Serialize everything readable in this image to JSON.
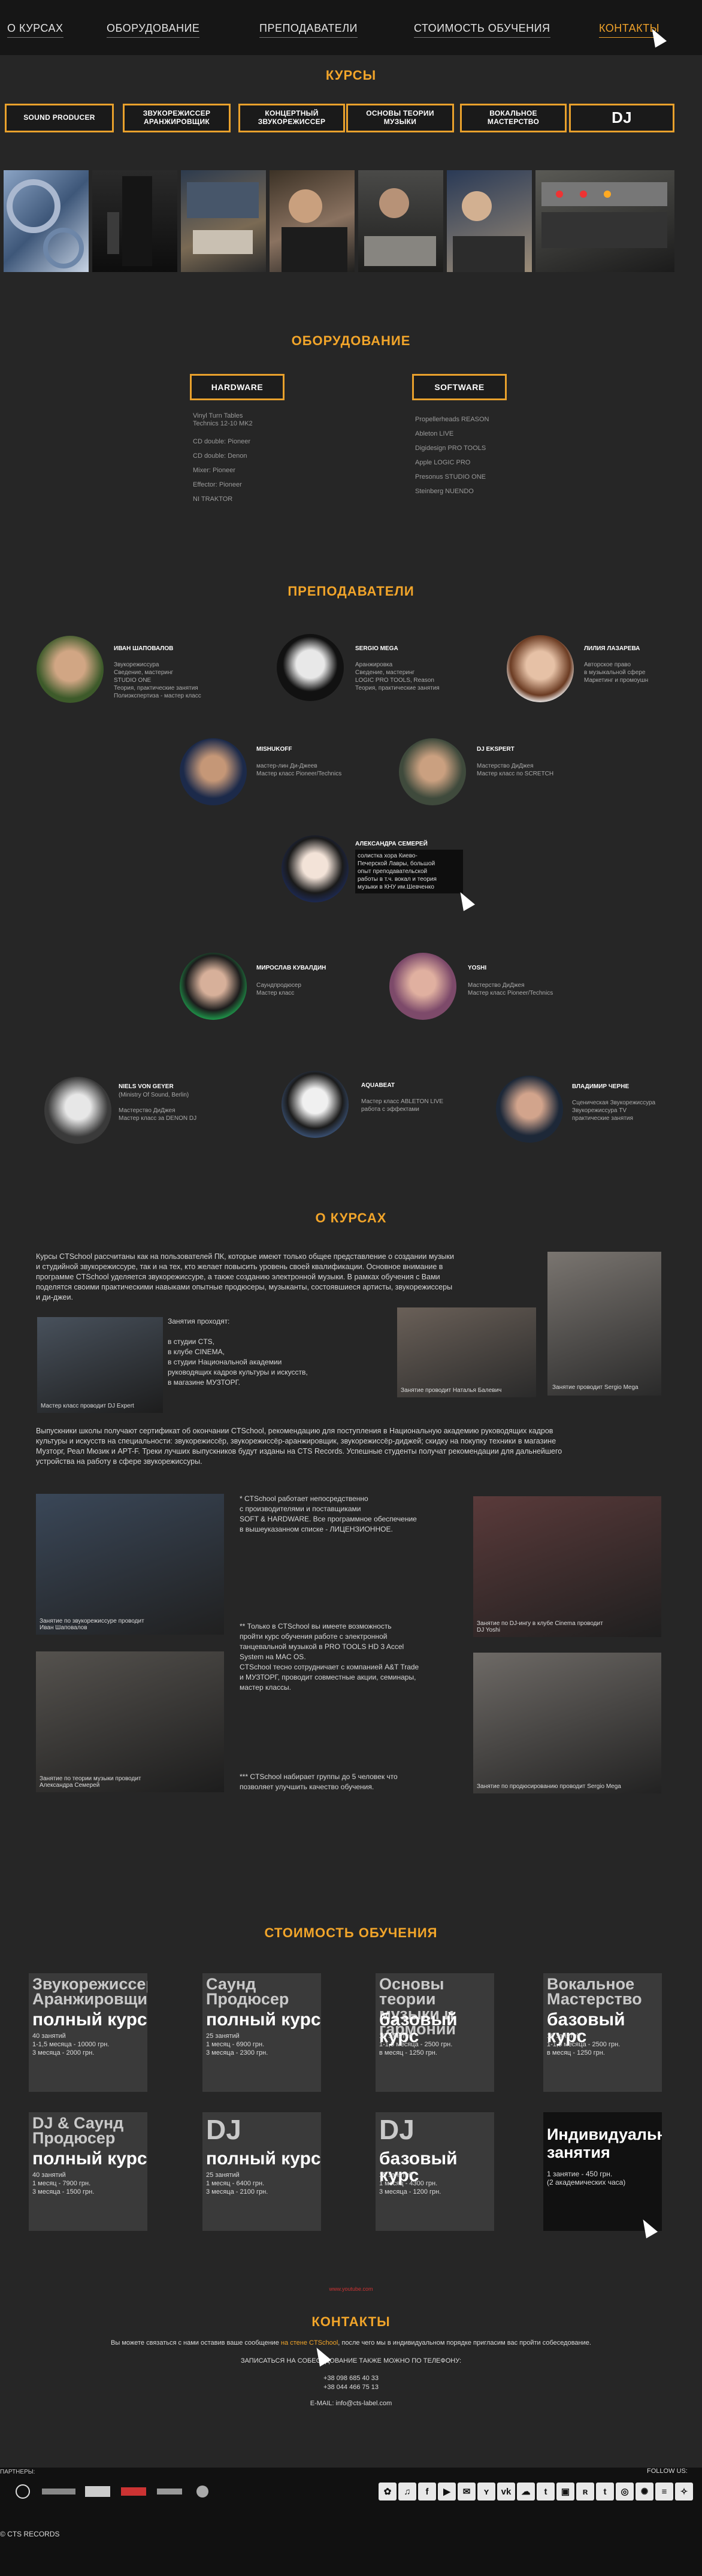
{
  "nav": {
    "items": [
      "О КУРСАХ",
      "ОБОРУДОВАНИЕ",
      "ПРЕПОДАВАТЕЛИ",
      "СТОИМОСТЬ ОБУЧЕНИЯ",
      "КОНТАКТЫ"
    ]
  },
  "courses": {
    "title": "КУРСЫ",
    "buttons": [
      "SOUND PRODUCER",
      "ЗВУКОРЕЖИССЕР\nАРАНЖИРОВЩИК",
      "КОНЦЕРТНЫЙ\nЗВУКОРЕЖИССЕР",
      "ОСНОВЫ ТЕОРИИ\nМУЗЫКИ",
      "ВОКАЛЬНОЕ\nМАСТЕРСТВО",
      "DJ"
    ]
  },
  "equipment": {
    "title": "ОБОРУДОВАНИЕ",
    "hardware_label": "HARDWARE",
    "software_label": "SOFTWARE",
    "hardware": [
      "Vinyl Turn Tables\nTechnics 12-10 MK2",
      "CD double: Pioneer",
      "CD double: Denon",
      "Mixer: Pioneer",
      "Effector: Pioneer",
      "NI TRAKTOR"
    ],
    "software": [
      "Propellerheads REASON",
      "Ableton LIVE",
      "Digidesign PRO TOOLS",
      "Apple LOGIC PRO",
      "Presonus STUDIO ONE",
      "Steinberg NUENDO"
    ]
  },
  "teachers": {
    "title": "ПРЕПОДАВАТЕЛИ",
    "list": [
      {
        "name": "ИВАН ШАПОВАЛОВ",
        "desc": "Звукорежиссура\nСведение, мастеринг\nSTUDIO ONE\nТеория, практические занятия\nПолиэкспертиза - мастер класс"
      },
      {
        "name": "SERGIO MEGA",
        "desc": "Аранжировка\nСведение, мастеринг\nLOGIC PRO TOOLS, Reason\nТеория, практические занятия"
      },
      {
        "name": "ЛИЛИЯ ЛАЗАРЕВА",
        "desc": "Авторское право\nв музыкальной сфере\nМаркетинг и промоушн"
      },
      {
        "name": "MISHUKOFF",
        "desc": "мастер-лин Ди-Джеев\nМастер класс Pioneer/Technics"
      },
      {
        "name": "DJ EKSPERT",
        "desc": "Мастерство ДиДжея\nМастер класс по SCRETCH"
      },
      {
        "name": "АЛЕКСАНДРА СЕМЕРЕЙ",
        "desc": "солистка хора Киево-\nПечерской Лавры, большой\nопыт преподавательской\nработы в т.ч. вокал и теория\nмузыки в КНУ им.Шевченко"
      },
      {
        "name": "МИРОСЛАВ КУВАЛДИН",
        "desc": "Саундпродюсер\nМастер класс"
      },
      {
        "name": "YOSHI",
        "desc": "Мастерство ДиДжея\nМастер класс Pioneer/Technics"
      },
      {
        "name": "NIELS VON GEYER",
        "desc": "(Ministry Of Sound, Berlin)\n\nМастерство ДиДжея\nМастер класс за DENON DJ"
      },
      {
        "name": "AQUABEAT",
        "desc": "Мастер класс ABLETON LIVE\nработа с эффектами"
      },
      {
        "name": "ВЛАДИМИР ЧЕРНЕ",
        "desc": "Сценическая Звукорежиссура\nЗвукорежиссура TV\nпрактические занятия"
      }
    ]
  },
  "about": {
    "title": "О КУРСАХ",
    "p1": "Курсы CTSchool рассчитаны как на пользователей ПК, которые имеют только общее представление о создании музыки\nи студийной звукорежиссуре, так и на тех, кто желает повысить уровень своей квалификации. Основное внимание в\nпрограмме CTSchool уделяется звукорежиссуре, а также созданию электронной музыки. В рамках обучения с Вами\nподелятся своими практическими навыками опытные продюсеры, музыканты, состоявшиеся артисты, звукорежиссеры\nи ди-джеи.",
    "p2": "Занятия проходят:\n\nв студии CTS,\nв клубе CINEMA,\nв студии Национальной академии\nруководящих кадров культуры и искусств,\nв магазине МУЗТОРГ.",
    "p3": "Выпускники школы получают сертификат об окончании CTSchool, рекомендацию для поступления в Национальную академию руководящих кадров\nкультуры и искусств на специальности: звукорежиссёр, звукорежиссёр-аранжировщик, звукорежиссёр-диджей; скидку на покупку техники в магазине\nМузторг, Реал Мюзик и APT-F. Треки лучших выпускников будут изданы на CTS Records. Успешные студенты получат рекомендации для дальнейшего\nустройства на работу в сфере звукорежиссуры.",
    "p4": "* CTSchool работает непосредственно\nс производителями и поставщиками\nSOFT & HARDWARE. Все программное обеспечение\nв вышеуказанном списке - ЛИЦЕНЗИОННОЕ.",
    "p5": "** Только в CTSchool вы имеете возможность\nпройти курс обучения работе с электронной\nтанцевальной музыкой в PRO TOOLS HD 3 Accel\nSystem на MAC OS.\nCTSchool тесно сотрудничает с компанией A&T Trade\nи МУЗТОРГ, проводит совместные акции, семинары,\nмастер классы.",
    "p6": "*** CTSchool набирает группы до 5 человек что\nпозволяет улучшить качество обучения.",
    "captions": [
      "Мастер класс проводит DJ Expert",
      "Занятие проводит Наталья Балевич",
      "Занятие проводит Sergio Mega",
      "Занятие по звукорежиссуре проводит\nИван Шаповалов",
      "Занятие по DJ-ингу в клубе Cinema проводит\nDJ Yoshi",
      "Занятие по теории музыки проводит\nАлександра Семерей",
      "Занятие по продюсированию проводит Sergio Mega"
    ]
  },
  "prices": {
    "title": "СТОИМОСТЬ ОБУЧЕНИЯ",
    "cards": [
      {
        "t1": "Звукорежиссер\nАранжировщик",
        "t2": "полный курс",
        "t3": "40 занятий\n1-1,5 месяца - 10000 грн.\n3 месяца - 2000 грн."
      },
      {
        "t1": "Саунд\nПродюсер",
        "t2": "полный курс",
        "t3": "25 занятий\n1 месяц - 6900 грн.\n3 месяца - 2300 грн."
      },
      {
        "t1": "Основы теории\nмузыки и гармонии",
        "t2": "базовый курс",
        "t3": "10 занятий\n1-1,5 месяца - 2500 грн.\nв месяц - 1250 грн."
      },
      {
        "t1": "Вокальное\nМастерство",
        "t2": "базовый курс",
        "t3": "10 занятий\n1-1,5 месяца - 2500 грн.\nв месяц - 1250 грн."
      },
      {
        "t1": "DJ & Саунд\nПродюсер",
        "t2": "полный курс",
        "t3": "40 занятий\n1 месяц - 7900 грн.\n3 месяца - 1500 грн."
      },
      {
        "t1": "DJ",
        "t2": "полный курс",
        "t3": "25 занятий\n1 месяц - 6400 грн.\n3 месяца - 2100 грн."
      },
      {
        "t1": "DJ",
        "t2": "базовый курс",
        "t3": "15 занятий\n1 месяц - 4300 грн.\n3 месяца - 1200 грн."
      },
      {
        "t1": "",
        "t2": "Индивидуальные\nзанятия",
        "t3": "1 занятие - 450 грн.\n(2 академических часа)"
      }
    ]
  },
  "small_link": "www.youtube.com",
  "contacts": {
    "title": "КОНТАКТЫ",
    "line1a": "Вы можете связаться с нами оставив ваше сообщение ",
    "line1link": "на стене CTSchool",
    "line1b": ", после чего мы в индивидуальном порядке пригласим вас пройти собеседование.",
    "line2": "ЗАПИСАТЬСЯ НА СОБЕСЕДОВАНИЕ ТАКЖЕ МОЖНО ПО ТЕЛЕФОНУ:",
    "phone1": "+38 098 685 40 33",
    "phone2": "+38 044 466 75 13",
    "email": "E-MAIL: info@cts-label.com"
  },
  "footer": {
    "partners_label": "ПАРТНЕРЫ:",
    "follow_label": "FOLLOW US:",
    "copyright": "© CTS RECORDS",
    "social": [
      "✿",
      "♫",
      "f",
      "▶",
      "✉",
      "ʏ",
      "vk",
      "☁",
      "t",
      "▣",
      "ʀ",
      "t",
      "◎",
      "✺",
      "≡",
      "✧"
    ]
  }
}
